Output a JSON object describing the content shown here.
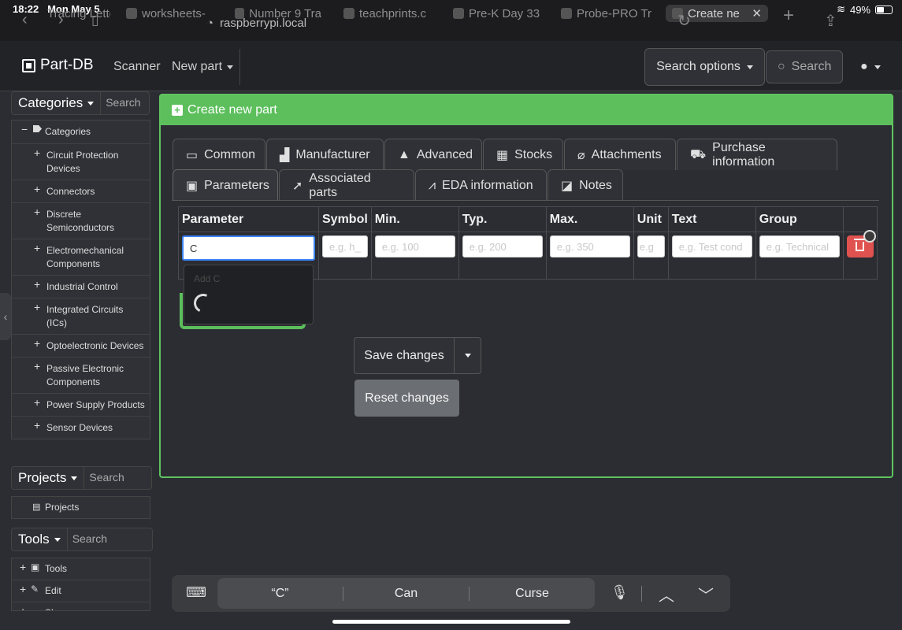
{
  "status": {
    "time": "18:22",
    "date": "Mon May 5",
    "battery": "49%"
  },
  "browser_tabs": [
    {
      "label": "Tracing Lette"
    },
    {
      "label": "worksheets-"
    },
    {
      "label": "Number 9 Tra"
    },
    {
      "label": "teachprints.c"
    },
    {
      "label": "Pre-K Day 33"
    },
    {
      "label": "Probe-PRO Tr"
    },
    {
      "label": "Create ne"
    }
  ],
  "url": "raspberrypi.local",
  "navbar": {
    "brand": "Part-DB",
    "scanner": "Scanner",
    "new_part": "New part",
    "search_options": "Search options",
    "search_placeholder": "Search"
  },
  "sidebar": {
    "categories_label": "Categories",
    "categories_search": "Search",
    "root": "Categories",
    "items": [
      "Circuit Protection Devices",
      "Connectors",
      "Discrete Semiconductors",
      "Electromechanical Components",
      "Industrial Control",
      "Integrated Circuits (ICs)",
      "Optoelectronic Devices",
      "Passive Electronic Components",
      "Power Supply Products",
      "Sensor Devices"
    ],
    "projects_label": "Projects",
    "projects_search": "Search",
    "projects_item": "Projects",
    "tools_label": "Tools",
    "tools_search": "Search",
    "tools_items": [
      "Tools",
      "Edit",
      "Sh"
    ]
  },
  "card": {
    "title": "Create new part",
    "tabs_row1": [
      "Common",
      "Manufacturer",
      "Advanced",
      "Stocks",
      "Attachments",
      "Purchase information"
    ],
    "tabs_row2": [
      "Parameters",
      "Associated parts",
      "EDA information",
      "Notes"
    ],
    "active_tab": "Parameters"
  },
  "param_table": {
    "headers": [
      "Parameter",
      "Symbol",
      "Min.",
      "Typ.",
      "Max.",
      "Unit",
      "Text",
      "Group"
    ],
    "row": {
      "parameter_value": "C",
      "symbol_placeholder": "e.g. h_",
      "min_placeholder": "e.g. 100",
      "typ_placeholder": "e.g. 200",
      "max_placeholder": "e.g. 350",
      "unit_placeholder": "e.g",
      "text_placeholder": "e.g. Test cond",
      "group_placeholder": "e.g. Technical"
    }
  },
  "autocomplete": {
    "item": "Add C"
  },
  "buttons": {
    "save": "Save changes",
    "reset": "Reset changes"
  },
  "keyboard": {
    "suggestions": [
      "“C”",
      "Can",
      "Curse"
    ]
  },
  "colors": {
    "accent_green": "#5cbf5c",
    "danger": "#e0524f",
    "focus_blue": "#3b82f6"
  }
}
